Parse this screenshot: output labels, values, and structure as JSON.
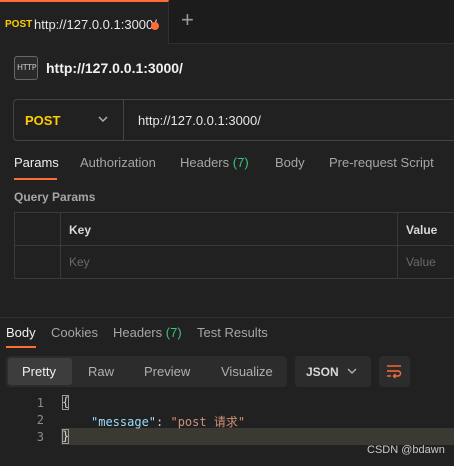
{
  "tab": {
    "method": "POST",
    "url": "http://127.0.0.1:3000/",
    "add_label": "+"
  },
  "request": {
    "icon_label": "HTTP",
    "title": "http://127.0.0.1:3000/",
    "method": "POST",
    "url": "http://127.0.0.1:3000/"
  },
  "req_tabs": {
    "params": "Params",
    "authorization": "Authorization",
    "headers": "Headers",
    "headers_count": "(7)",
    "body": "Body",
    "prerequest": "Pre-request Script"
  },
  "query_params": {
    "title": "Query Params",
    "key_header": "Key",
    "value_header": "Value",
    "key_placeholder": "Key",
    "value_placeholder": "Value"
  },
  "resp_tabs": {
    "body": "Body",
    "cookies": "Cookies",
    "headers": "Headers",
    "headers_count": "(7)",
    "test_results": "Test Results"
  },
  "view_modes": {
    "pretty": "Pretty",
    "raw": "Raw",
    "preview": "Preview",
    "visualize": "Visualize"
  },
  "format": "JSON",
  "code": {
    "line_numbers": [
      "1",
      "2",
      "3"
    ],
    "open_brace": "{",
    "key": "\"message\"",
    "colon": ": ",
    "value": "\"post 请求\"",
    "close_brace": "}"
  },
  "watermark": "CSDN @bdawn",
  "colors": {
    "accent": "#ff6c37",
    "method": "#ffcc00",
    "count": "#3ac47d"
  }
}
